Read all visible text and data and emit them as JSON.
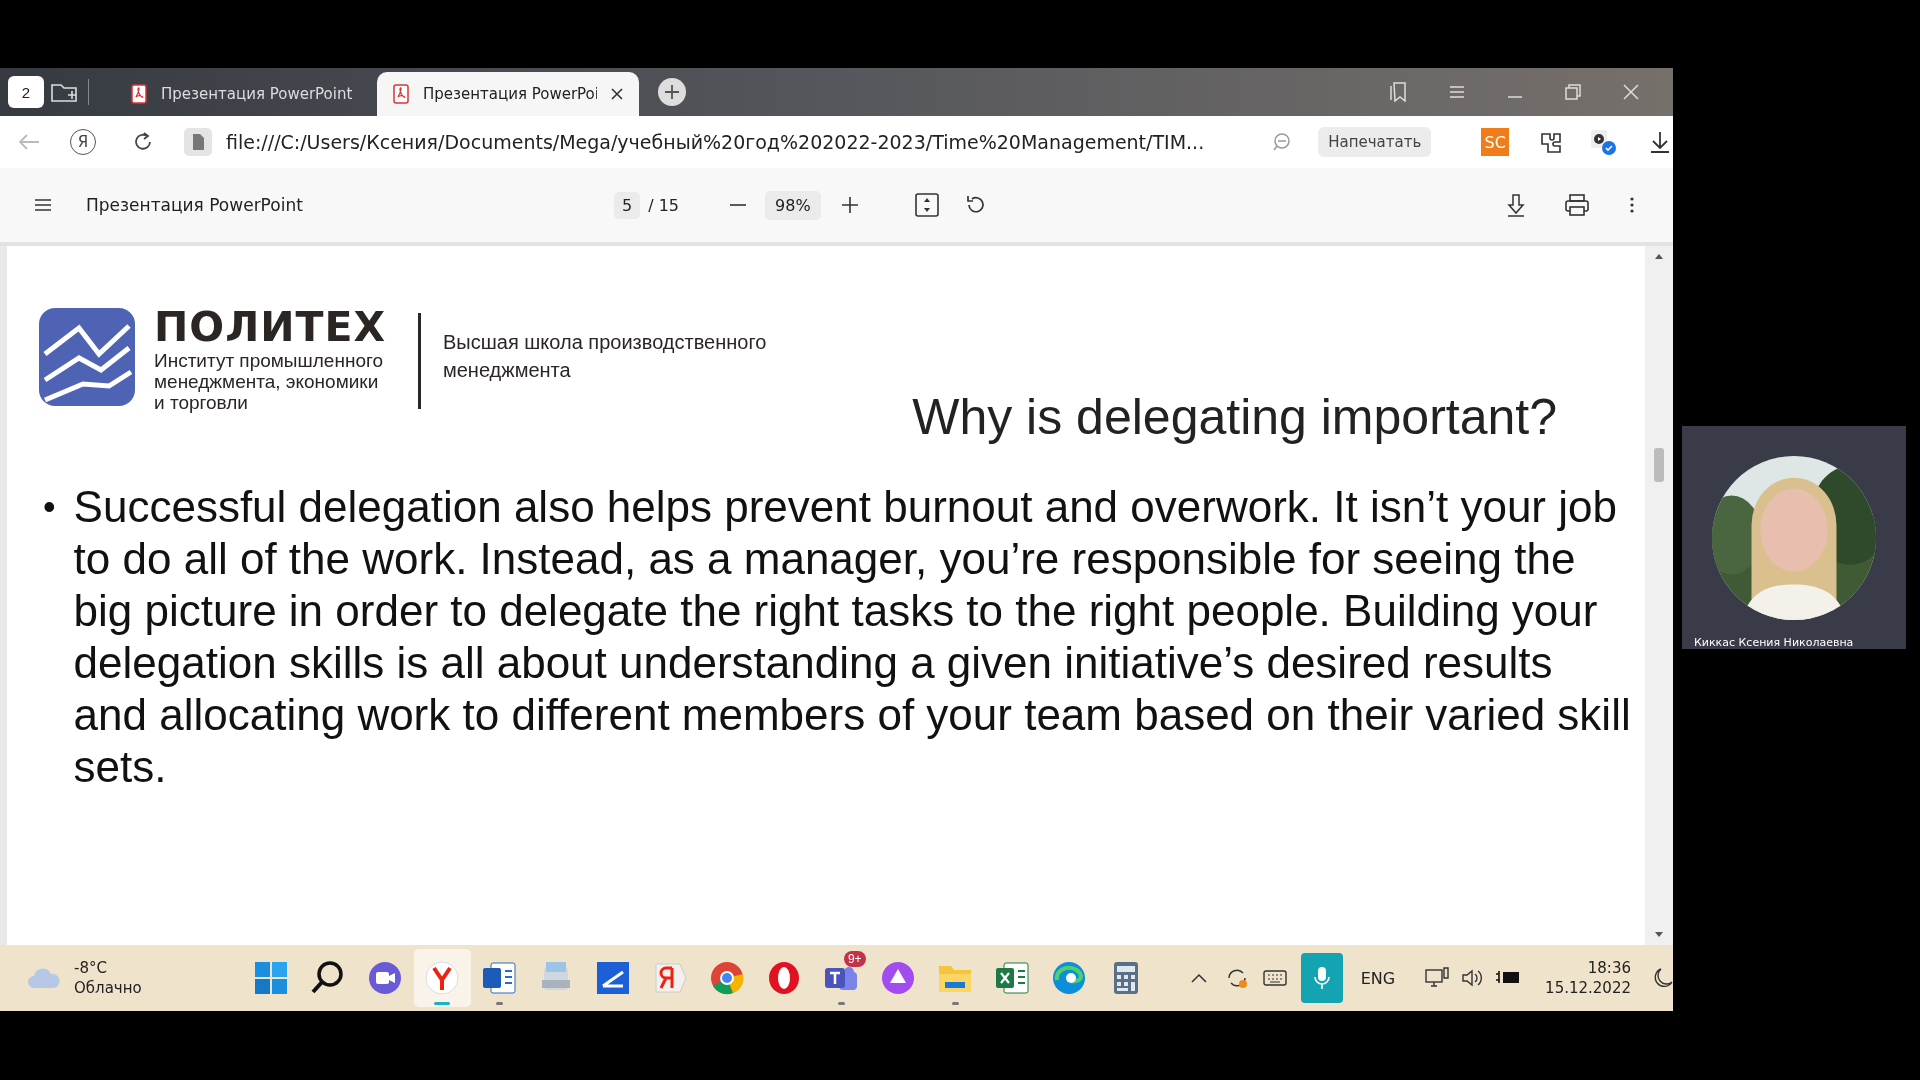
{
  "browser": {
    "tab_count": "2",
    "tabs": [
      {
        "title": "Презентация PowerPoint",
        "selected": false
      },
      {
        "title": "Презентация PowerPoi",
        "selected": true
      }
    ],
    "address_bar": {
      "yandex_glyph": "Я",
      "url": "file:///C:/Users/Ксения/Documents/Mega/учебный%20год%202022-2023/Time%20Management/TIM...",
      "print_button": "Напечатать",
      "extension_label": "SC"
    }
  },
  "pdf_toolbar": {
    "title": "Презентация PowerPoint",
    "page_current": "5",
    "page_total": "/ 15",
    "zoom": "98%"
  },
  "slide": {
    "logo": {
      "brand": "ПОЛИТЕХ",
      "institute": "Институт промышленного менеджмента, экономики и торговли",
      "school": "Высшая школа производственного менеджмента"
    },
    "title": "Why is delegating important?",
    "bullet_marker": "•",
    "bullets": [
      "Successful delegation also helps prevent burnout and overwork. It isn’t your job to do all of the work. Instead, as a manager, you’re responsible for seeing the big picture in order to delegate the right tasks to the right people. Building your delegation skills is all about understanding a given initiative’s desired results and allocating work to different members of your team based on their varied skill sets."
    ]
  },
  "taskbar": {
    "weather": {
      "temperature": "-8°C",
      "condition": "Облачно"
    },
    "apps": [
      {
        "kind": "start",
        "active": false,
        "running": false
      },
      {
        "kind": "search",
        "active": false,
        "running": false
      },
      {
        "kind": "meet",
        "active": false,
        "running": false
      },
      {
        "kind": "yandex-browser",
        "active": true,
        "running": false
      },
      {
        "kind": "word",
        "active": false,
        "running": true
      },
      {
        "kind": "scanner",
        "active": false,
        "running": false
      },
      {
        "kind": "scan-app",
        "active": false,
        "running": false
      },
      {
        "kind": "yandex",
        "active": false,
        "running": false
      },
      {
        "kind": "chrome",
        "active": false,
        "running": false
      },
      {
        "kind": "opera",
        "active": false,
        "running": false
      },
      {
        "kind": "teams",
        "active": false,
        "running": true,
        "badge": "9+"
      },
      {
        "kind": "alice",
        "active": false,
        "running": false
      },
      {
        "kind": "explorer",
        "active": false,
        "running": true
      },
      {
        "kind": "excel",
        "active": false,
        "running": false
      },
      {
        "kind": "edge",
        "active": false,
        "running": false
      },
      {
        "kind": "calculator",
        "active": false,
        "running": false
      }
    ],
    "language": "ENG",
    "time": "18:36",
    "date": "15.12.2022"
  },
  "participant": {
    "name": "Киккас Ксения Николаевна"
  }
}
